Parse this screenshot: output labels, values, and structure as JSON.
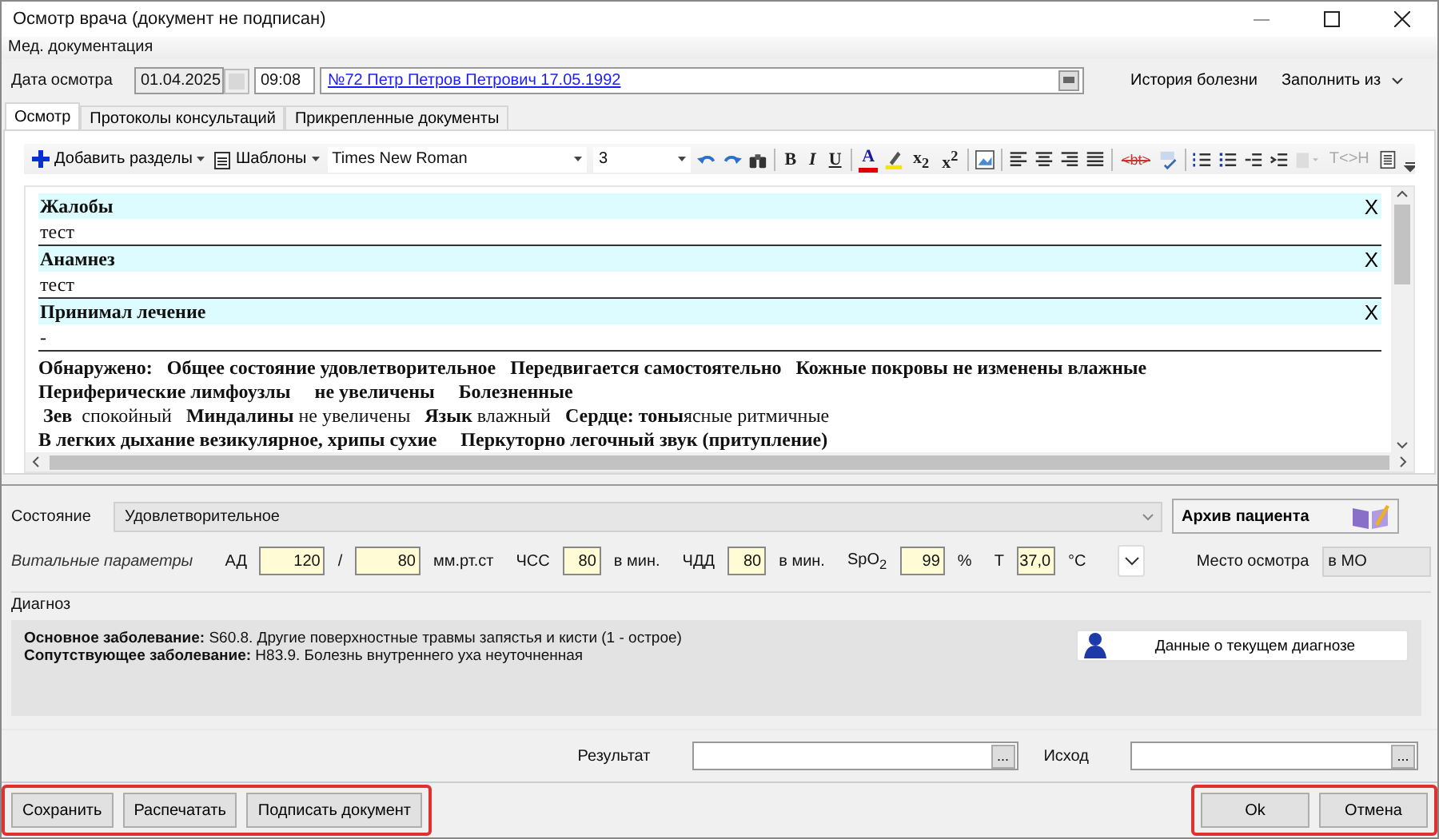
{
  "window": {
    "title": "Осмотр врача (документ не подписан)"
  },
  "menu": [
    {
      "label": "Мед. документация"
    }
  ],
  "header": {
    "date_label": "Дата осмотра",
    "date": "01.04.2025",
    "time": "09:08",
    "patient": "№72 Петр Петров Петрович 17.05.1992",
    "history_button": "История болезни",
    "fill_button": "Заполнить из"
  },
  "tabs": [
    {
      "label": "Осмотр",
      "selected": true
    },
    {
      "label": "Протоколы консультаций",
      "selected": false
    },
    {
      "label": "Прикрепленные документы",
      "selected": false
    }
  ],
  "toolbar": {
    "add_sections": "Добавить разделы",
    "templates": "Шаблоны",
    "font": "Times New Roman",
    "size": "3",
    "format_buttons": [
      {
        "kind": "bold",
        "label": "B"
      },
      {
        "kind": "italic",
        "label": "I"
      },
      {
        "kind": "underline",
        "label": "U"
      },
      {
        "kind": "font-color",
        "label": "A"
      }
    ],
    "script_buttons": [
      "x$_{2}$",
      "x$^{2}$"
    ],
    "tag_button": "<bt>",
    "convert_button": {
      "label": "T<>H",
      "disabled": true
    }
  },
  "editor": {
    "sections": [
      {
        "title": "Жалобы",
        "text": "тест",
        "remove": "X"
      },
      {
        "title": "Анамнез",
        "text": "тест",
        "remove": "X"
      },
      {
        "title": "Принимал лечение",
        "text": "-",
        "remove": "X"
      }
    ],
    "findings": [
      {
        "text": "Обнаружено:   Общее состояние удовлетворительное   Передвигается самостоятельно   Кожные покровы не изменены влажные",
        "bold": true
      },
      {
        "text": "Периферические лимфоузлы     не увеличены     Болезненные",
        "bold": true
      },
      {
        "text": " **Зев**  спокойный   **Миндалины** не увеличены   **Язык** влажный   **Сердце: тоны**ясные ритмичные",
        "bold": false
      },
      {
        "text": "В легких дыхание везикулярное, хрипы сухие     Перкуторно легочный звук (притупление)",
        "bold": true
      }
    ]
  },
  "state": {
    "label": "Состояние",
    "value": "Удовлетворительное",
    "archive_button": "Архив пациента"
  },
  "vitals": {
    "label": "Витальные параметры",
    "items": [
      {
        "label": "АД",
        "value": "120",
        "unit": "/"
      },
      {
        "value": "80",
        "unit": "мм.рт.ст"
      },
      {
        "label": "ЧСС",
        "value": "80",
        "unit": "в мин."
      },
      {
        "label": "ЧДД",
        "value": "80",
        "unit": "в мин."
      },
      {
        "label": "SpO$_{2}$",
        "value": "99",
        "unit": "%"
      },
      {
        "label": "Т",
        "value": "37,0",
        "unit": "°C"
      }
    ],
    "place_label": "Место осмотра",
    "place": "в МО"
  },
  "diagnosis": {
    "label": "Диагноз",
    "lines": [
      "**Основное заболевание:** S60.8. Другие поверхностные травмы запястья и кисти (1 - острое)",
      "**Сопутствующее заболевание:** H83.9. Болезнь внутреннего уха неуточненная"
    ],
    "details_button": "Данные о текущем диагнозе"
  },
  "result": {
    "result_label": "Результат",
    "outcome_label": "Исход",
    "browse": "..."
  },
  "buttons_left": [
    "Сохранить",
    "Распечатать",
    "Подписать документ"
  ],
  "buttons_right": [
    "Ok",
    "Отмена"
  ]
}
